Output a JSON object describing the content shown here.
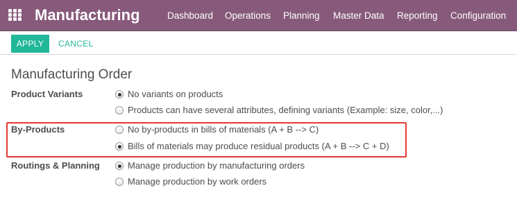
{
  "navbar": {
    "brand": "Manufacturing",
    "menu": [
      "Dashboard",
      "Operations",
      "Planning",
      "Master Data",
      "Reporting",
      "Configuration"
    ]
  },
  "controls": {
    "apply_label": "APPLY",
    "cancel_label": "CANCEL"
  },
  "section_title": "Manufacturing Order",
  "settings": [
    {
      "label": "Product Variants",
      "options": [
        {
          "text": "No variants on products",
          "selected": true
        },
        {
          "text": "Products can have several attributes, defining variants (Example: size, color,...)",
          "selected": false
        }
      ]
    },
    {
      "label": "By-Products",
      "highlighted": true,
      "options": [
        {
          "text": "No by-products in bills of materials (A + B --> C)",
          "selected": false
        },
        {
          "text": "Bills of materials may produce residual products (A + B --> C + D)",
          "selected": true
        }
      ]
    },
    {
      "label": "Routings & Planning",
      "options": [
        {
          "text": "Manage production by manufacturing orders",
          "selected": true
        },
        {
          "text": "Manage production by work orders",
          "selected": false
        }
      ]
    }
  ],
  "colors": {
    "navbar": "#875a7b",
    "primary_button": "#21b799",
    "highlight_border": "#e53935"
  }
}
